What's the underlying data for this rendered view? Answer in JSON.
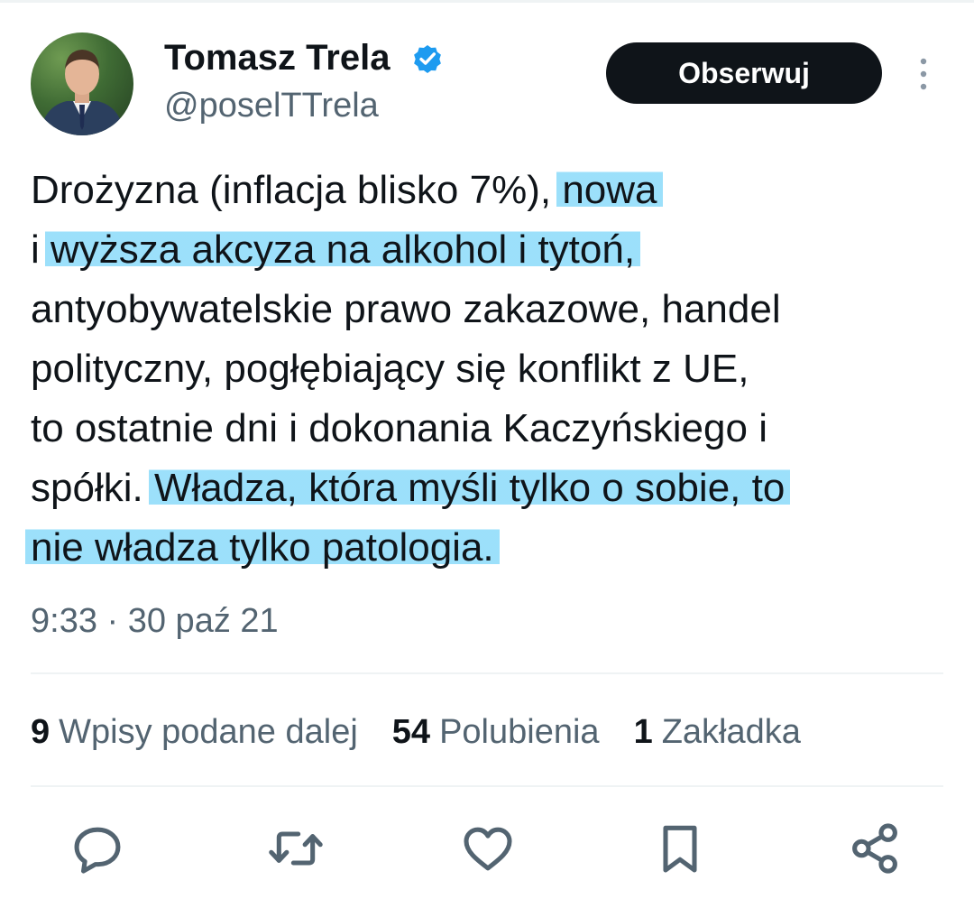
{
  "author": {
    "name": "Tomasz Trela",
    "handle": "@poselTTrela",
    "verified": true,
    "avatar": "avatar-photo"
  },
  "follow_button": {
    "label": "Obserwuj"
  },
  "tweet": {
    "lines": [
      [
        "Drożyzna (inflacja blisko 7%), ",
        "nowa"
      ],
      [
        "i ",
        "wyższa akcyza na alkohol i tytoń,"
      ],
      [
        "antyobywatelskie prawo zakazowe, handel"
      ],
      [
        "polityczny, pogłębiający się konflikt z UE,"
      ],
      [
        "to ostatnie dni i dokonania Kaczyńskiego i"
      ],
      [
        "spółki. ",
        "Władza, która myśli tylko o sobie, to"
      ],
      [
        "",
        "nie władza tylko patologia."
      ]
    ],
    "highlight_color": "#5fcdf8",
    "timestamp": "9:33 · 30 paź 21"
  },
  "stats": [
    {
      "count": "9",
      "label": "Wpisy podane dalej"
    },
    {
      "count": "54",
      "label": "Polubienia"
    },
    {
      "count": "1",
      "label": "Zakładka"
    }
  ],
  "actions": [
    "reply-icon",
    "retweet-icon",
    "like-icon",
    "bookmark-icon",
    "share-icon"
  ],
  "colors": {
    "text": "#0f1419",
    "secondary": "#536471",
    "divider": "#eff3f4",
    "verified": "#1d9bf0",
    "button": "#0f1419"
  }
}
